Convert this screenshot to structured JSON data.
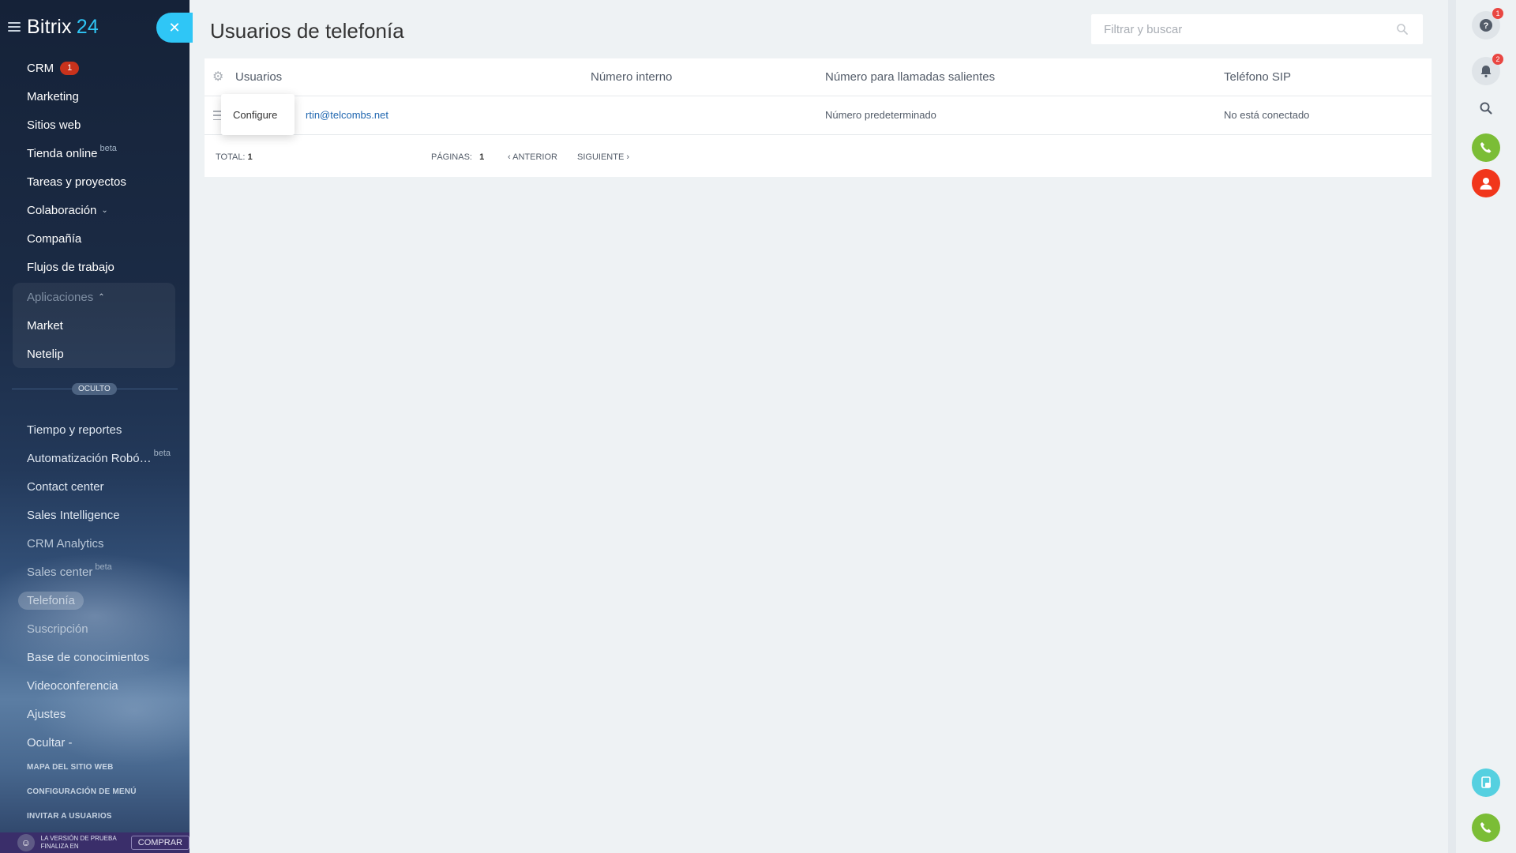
{
  "app": {
    "logo_text": "Bitrix",
    "logo_number": "24"
  },
  "sidebar": {
    "items_top": [
      {
        "label": "CRM",
        "badge": "1"
      },
      {
        "label": "Marketing"
      },
      {
        "label": "Sitios web"
      },
      {
        "label": "Tienda online",
        "sup": "beta"
      },
      {
        "label": "Tareas y proyectos"
      },
      {
        "label": "Colaboración",
        "chevron": "⌄"
      },
      {
        "label": "Compañía"
      },
      {
        "label": "Flujos de trabajo"
      }
    ],
    "apps_group": {
      "label": "Aplicaciones",
      "chevron": "⌃",
      "items": [
        "Market",
        "Netelip"
      ]
    },
    "hidden_label": "OCULTO",
    "items_hidden": [
      {
        "label": "Tiempo y reportes"
      },
      {
        "label": "Automatización Robó…",
        "sup": "beta"
      },
      {
        "label": "Contact center"
      },
      {
        "label": "Sales Intelligence"
      },
      {
        "label": "CRM Analytics"
      },
      {
        "label": "Sales center",
        "sup": "beta"
      },
      {
        "label": "Telefonía"
      },
      {
        "label": "Suscripción"
      },
      {
        "label": "Base de conocimientos"
      },
      {
        "label": "Videoconferencia"
      },
      {
        "label": "Ajustes"
      },
      {
        "label": "Ocultar -"
      }
    ],
    "bottom_links": [
      "MAPA DEL SITIO WEB",
      "CONFIGURACIÓN DE MENÚ",
      "INVITAR A USUARIOS"
    ],
    "trial_text": "LA VERSIÓN DE PRUEBA FINALIZA EN",
    "buy_label": "COMPRAR"
  },
  "main": {
    "title": "Usuarios de telefonía",
    "search_placeholder": "Filtrar y buscar",
    "columns": [
      "Usuarios",
      "Número interno",
      "Número para llamadas salientes",
      "Teléfono SIP"
    ],
    "rows": [
      {
        "user": "rtin@telcombs.net",
        "internal": "",
        "outgoing": "Número predeterminado",
        "sip": "No está conectado"
      }
    ],
    "popup_label": "Configure",
    "footer": {
      "total_label": "TOTAL:",
      "total_value": "1",
      "pages_label": "PÁGINAS:",
      "pages_value": "1",
      "prev_label": "ANTERIOR",
      "next_label": "SIGUIENTE"
    }
  },
  "rail": {
    "help_badge": "1",
    "notif_badge": "2"
  },
  "colors": {
    "accent": "#2fc6f6",
    "link": "#2067b0",
    "badge": "#c8321c",
    "phone_green": "#7bbd36",
    "user_red": "#f1361b"
  }
}
